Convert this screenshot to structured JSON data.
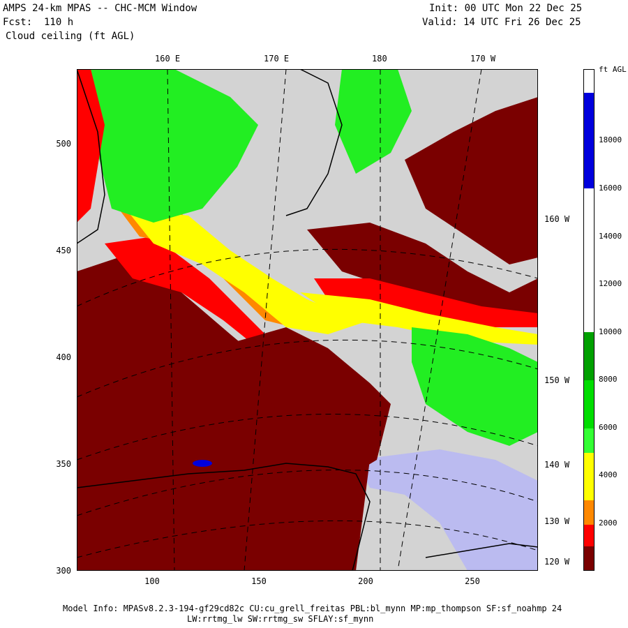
{
  "header": {
    "title": "AMPS 24-km MPAS -- CHC-MCM Window",
    "forecast": "Fcst:  110 h",
    "field": "Cloud ceiling (ft AGL)",
    "init": "Init: 00 UTC Mon 22 Dec 25",
    "valid": "Valid: 14 UTC Fri 26 Dec 25"
  },
  "axes": {
    "x_ticks": [
      "100",
      "150",
      "200",
      "250"
    ],
    "y_ticks": [
      "500",
      "450",
      "400",
      "350",
      "300"
    ],
    "lon_top": [
      "160 E",
      "170 E",
      "180",
      "170 W"
    ],
    "lon_right": [
      "160 W",
      "150 W",
      "140 W",
      "130 W",
      "120 W"
    ]
  },
  "colorbar": {
    "unit": "ft AGL",
    "labels": [
      "18000",
      "16000",
      "14000",
      "12000",
      "10000",
      "8000",
      "6000",
      "4000",
      "2000"
    ],
    "colors": {
      "white": "#ffffff",
      "blue": "#0000dd",
      "dark_green": "#00a000",
      "green": "#00dd00",
      "light_green": "#33ff33",
      "yellow": "#ffff00",
      "orange": "#ff8800",
      "red": "#ff0000",
      "dark_red": "#7a0000"
    }
  },
  "map_colors": {
    "land_gray": "#d3d3d3",
    "lavender": "#bbbbf0",
    "dark_red": "#7a0000",
    "red": "#ff0000",
    "orange": "#ff8800",
    "yellow": "#ffff00",
    "green": "#22ee22",
    "blue": "#0000dd"
  },
  "footer": {
    "line1": "Model Info: MPASv8.2.3-194-gf29cd82c CU:cu_grell_freitas PBL:bl_mynn MP:mp_thompson SF:sf_noahmp 24",
    "line2": "LW:rrtmg_lw SW:rrtmg_sw SFLAY:sf_mynn"
  }
}
